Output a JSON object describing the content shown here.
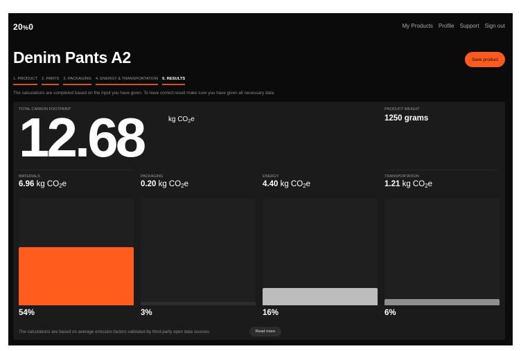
{
  "brand": {
    "logo": "20%0"
  },
  "nav": [
    "My Products",
    "Profile",
    "Support",
    "Sign out"
  ],
  "page_title": "Denim Pants A2",
  "save_button": "Save product",
  "steps": [
    {
      "label": "1. PRODUCT",
      "active": false
    },
    {
      "label": "2. PARTS",
      "active": false
    },
    {
      "label": "3. PACKAGING",
      "active": false
    },
    {
      "label": "4. ENERGY & TRANSPORTATION",
      "active": false
    },
    {
      "label": "5. RESULTS",
      "active": true
    }
  ],
  "notice": "The calculations are completed based on the input you have given. To have correct result make sure you have given all necessary data.",
  "total": {
    "label": "TOTAL CARBON FOOTPRINT",
    "value": "12.68",
    "unit_prefix": "kg CO",
    "unit_sub": "2",
    "unit_suffix": "e"
  },
  "weight": {
    "label": "PRODUCT WEIGHT",
    "value": "1250 grams"
  },
  "categories": [
    {
      "label": "MATERIALS",
      "value": "6.96",
      "unit_prefix": "kg CO",
      "unit_sub": "2",
      "unit_suffix": "e",
      "percent_text": "54%",
      "share": 0.54,
      "bar_color": "#ff5c1e"
    },
    {
      "label": "PACKAGING",
      "value": "0.20",
      "unit_prefix": "kg CO",
      "unit_sub": "2",
      "unit_suffix": "e",
      "percent_text": "3%",
      "share": 0.03,
      "bar_color": "#2e2e2e"
    },
    {
      "label": "ENERGY",
      "value": "4.40",
      "unit_prefix": "kg CO",
      "unit_sub": "2",
      "unit_suffix": "e",
      "percent_text": "16%",
      "share": 0.16,
      "bar_color": "#bdbdbd"
    },
    {
      "label": "TRANSPORTATION",
      "value": "1.21",
      "unit_prefix": "kg CO",
      "unit_sub": "2",
      "unit_suffix": "e",
      "percent_text": "6%",
      "share": 0.06,
      "bar_color": "#8f8f8f"
    }
  ],
  "footer_note": "The calculations are based on average emission factors validated by third-party open data sources.",
  "read_more": "Read more",
  "colors": {
    "accent": "#ff5a1f",
    "background": "#0b0b0b",
    "panel": "#1b1b1b"
  }
}
